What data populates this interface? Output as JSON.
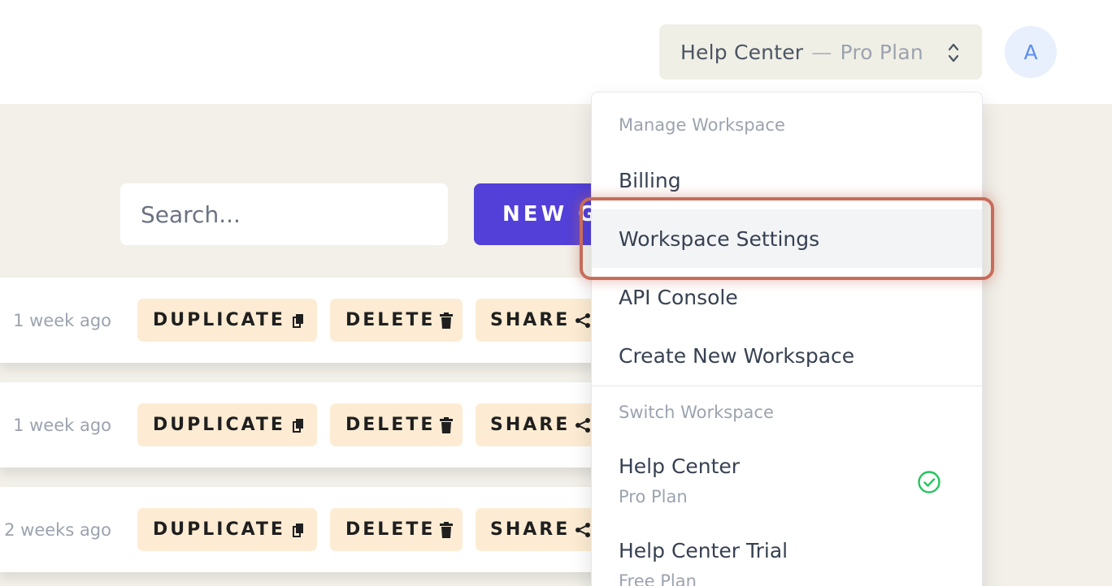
{
  "header": {
    "workspace_name": "Help Center",
    "separator": "—",
    "workspace_plan": "Pro Plan",
    "avatar_initial": "A"
  },
  "toolbar": {
    "search_placeholder": "Search...",
    "new_button_label": "NEW G"
  },
  "rows": [
    {
      "time": "1 week ago",
      "duplicate": "DUPLICATE",
      "delete": "DELETE",
      "share": "SHARE"
    },
    {
      "time": "1 week ago",
      "duplicate": "DUPLICATE",
      "delete": "DELETE",
      "share": "SHARE"
    },
    {
      "time": "2 weeks ago",
      "duplicate": "DUPLICATE",
      "delete": "DELETE",
      "share": "SHARE"
    }
  ],
  "dropdown": {
    "manage_heading": "Manage Workspace",
    "items": [
      {
        "label": "Billing"
      },
      {
        "label": "Workspace Settings"
      },
      {
        "label": "API Console"
      },
      {
        "label": "Create New Workspace"
      }
    ],
    "switch_heading": "Switch Workspace",
    "workspaces": [
      {
        "name": "Help Center",
        "plan": "Pro Plan",
        "selected": true
      },
      {
        "name": "Help Center Trial",
        "plan": "Free Plan",
        "selected": false
      }
    ]
  },
  "colors": {
    "accent": "#5240d8",
    "action_bg": "#fdecd3",
    "highlight": "#c86c5a",
    "selected_check": "#22c55e"
  },
  "icons": {
    "workspace_switch": "chevron-up-down-icon",
    "duplicate": "copy-icon",
    "delete": "trash-icon",
    "share": "share-icon",
    "selected": "check-circle-icon"
  }
}
